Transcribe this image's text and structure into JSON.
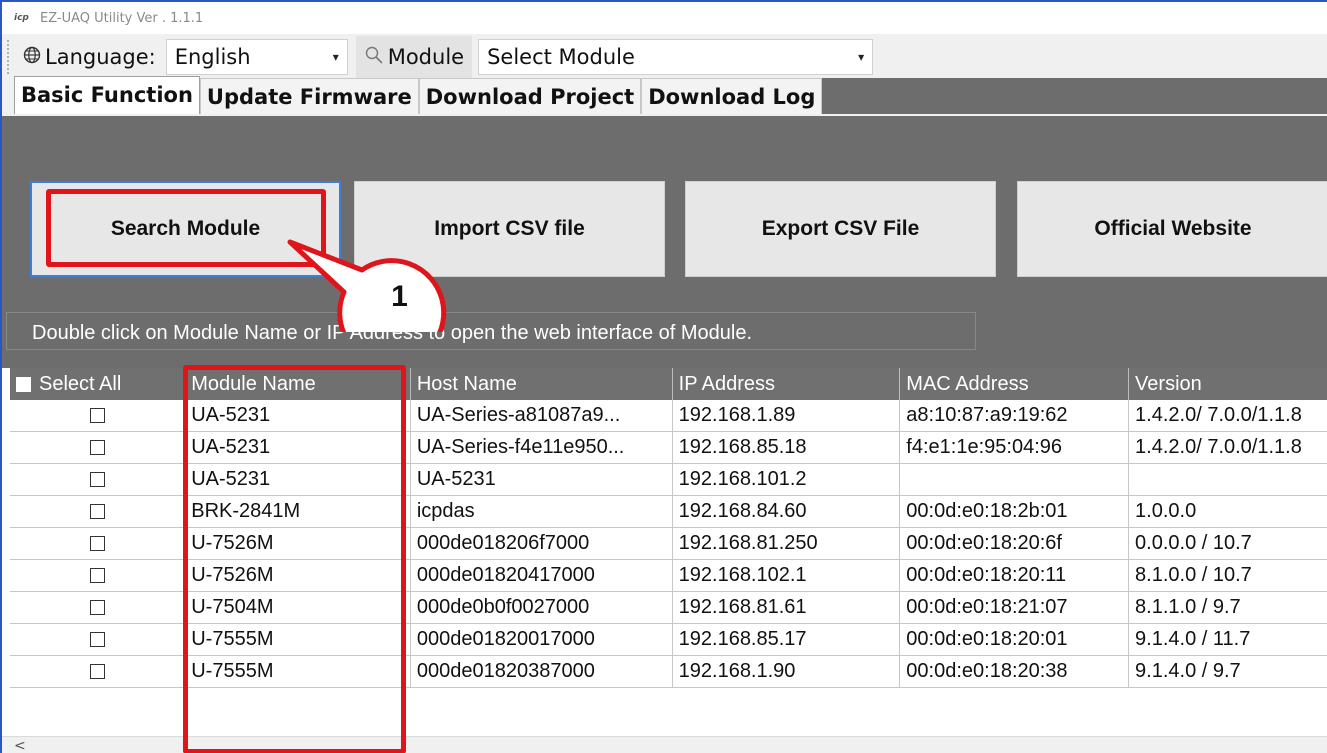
{
  "window": {
    "title": "EZ-UAQ Utility Ver . 1.1.1",
    "icon": "icpdas-logo-icon"
  },
  "toolbar": {
    "language_label": "Language:",
    "language_value": "English",
    "module_label": "Module",
    "module_value": "Select Module"
  },
  "tabs": [
    "Basic Function",
    "Update Firmware",
    "Download Project",
    "Download Log"
  ],
  "buttons": {
    "search": "Search Module",
    "import": "Import CSV file",
    "export": "Export CSV File",
    "website": "Official Website"
  },
  "hint": "Double click on Module Name or IP Address to open the web interface of Module.",
  "callout": {
    "number": "1"
  },
  "grid": {
    "headers": [
      "Select All",
      "Module Name",
      "Host Name",
      "IP Address",
      "MAC Address",
      "Version"
    ],
    "rows": [
      [
        "UA-5231",
        "UA-Series-a81087a9...",
        "192.168.1.89",
        "a8:10:87:a9:19:62",
        "1.4.2.0/ 7.0.0/1.1.8"
      ],
      [
        "UA-5231",
        "UA-Series-f4e11e950...",
        "192.168.85.18",
        "f4:e1:1e:95:04:96",
        "1.4.2.0/ 7.0.0/1.1.8"
      ],
      [
        "UA-5231",
        "UA-5231",
        "192.168.101.2",
        "",
        ""
      ],
      [
        "BRK-2841M",
        "icpdas",
        "192.168.84.60",
        "00:0d:e0:18:2b:01",
        "1.0.0.0"
      ],
      [
        "U-7526M",
        "000de018206f7000",
        "192.168.81.250",
        "00:0d:e0:18:20:6f",
        "0.0.0.0 / 10.7"
      ],
      [
        "U-7526M",
        "000de01820417000",
        "192.168.102.1",
        "00:0d:e0:18:20:11",
        "8.1.0.0 / 10.7"
      ],
      [
        "U-7504M",
        "000de0b0f0027000",
        "192.168.81.61",
        "00:0d:e0:18:21:07",
        "8.1.1.0 / 9.7"
      ],
      [
        "U-7555M",
        "000de01820017000",
        "192.168.85.17",
        "00:0d:e0:18:20:01",
        "9.1.4.0 / 11.7"
      ],
      [
        "U-7555M",
        "000de01820387000",
        "192.168.1.90",
        "00:0d:e0:18:20:38",
        "9.1.4.0 / 9.7"
      ]
    ]
  },
  "colors": {
    "highlight": "#e0151c",
    "panel": "#6d6d6d",
    "header": "#707070",
    "focus": "#3c7fd6"
  }
}
